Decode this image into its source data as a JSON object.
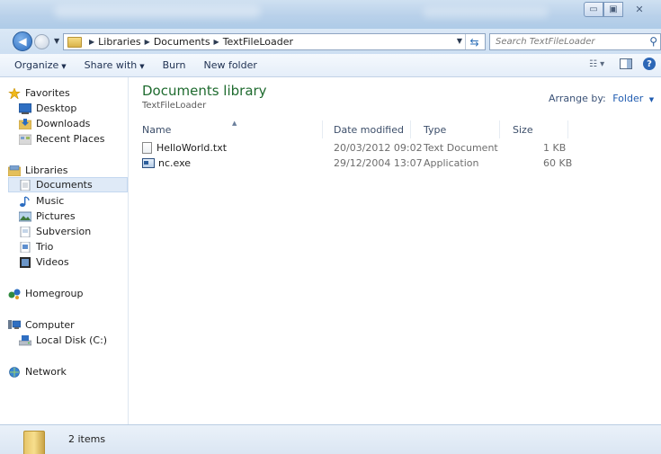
{
  "window": {
    "controls": {
      "minimize": "▭",
      "maximize": "▣",
      "close": "✕"
    }
  },
  "nav": {
    "breadcrumb": [
      "Libraries",
      "Documents",
      "TextFileLoader"
    ],
    "search_placeholder": "Search TextFileLoader"
  },
  "toolbar": {
    "organize": "Organize",
    "share_with": "Share with",
    "burn": "Burn",
    "new_folder": "New folder"
  },
  "sidebar": {
    "favorites": "Favorites",
    "desktop": "Desktop",
    "downloads": "Downloads",
    "recent_places": "Recent Places",
    "libraries": "Libraries",
    "documents": "Documents",
    "music": "Music",
    "pictures": "Pictures",
    "subversion": "Subversion",
    "trio": "Trio",
    "videos": "Videos",
    "homegroup": "Homegroup",
    "computer": "Computer",
    "local_disk": "Local Disk (C:)",
    "network": "Network"
  },
  "main": {
    "title": "Documents library",
    "subtitle": "TextFileLoader",
    "arrange_label": "Arrange by:",
    "arrange_value": "Folder",
    "columns": {
      "name": "Name",
      "date": "Date modified",
      "type": "Type",
      "size": "Size"
    },
    "files": [
      {
        "name": "HelloWorld.txt",
        "date": "20/03/2012 09:02",
        "type": "Text Document",
        "size": "1 KB"
      },
      {
        "name": "nc.exe",
        "date": "29/12/2004 13:07",
        "type": "Application",
        "size": "60 KB"
      }
    ]
  },
  "status": {
    "items": "2 items"
  },
  "colors": {
    "library_title": "#1f6b2f",
    "accent_blue": "#1f5bb0",
    "selection": "#dfeaf7"
  }
}
